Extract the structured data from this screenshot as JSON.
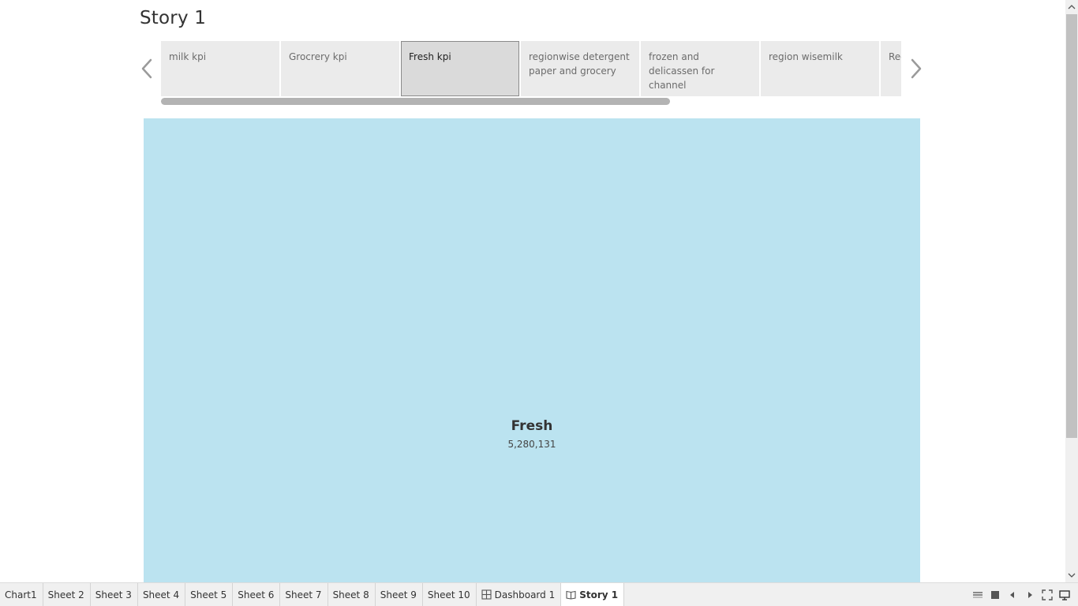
{
  "story": {
    "title": "Story 1",
    "points": [
      {
        "label": "milk kpi",
        "active": false
      },
      {
        "label": "Grocrery kpi",
        "active": false
      },
      {
        "label": "Fresh kpi",
        "active": true
      },
      {
        "label": "regionwise detergent paper and grocery",
        "active": false
      },
      {
        "label": "frozen and delicassen for channel",
        "active": false
      },
      {
        "label": "region wisemilk",
        "active": false
      },
      {
        "label": "Region",
        "active": false
      }
    ]
  },
  "viz": {
    "tile_name": "Fresh",
    "tile_value": "5,280,131",
    "tile_color": "#bbe3f0"
  },
  "tabs": [
    {
      "label": "Chart1",
      "icon": null
    },
    {
      "label": "Sheet 2",
      "icon": null
    },
    {
      "label": "Sheet 3",
      "icon": null
    },
    {
      "label": "Sheet 4",
      "icon": null
    },
    {
      "label": "Sheet 5",
      "icon": null
    },
    {
      "label": "Sheet 6",
      "icon": null
    },
    {
      "label": "Sheet 7",
      "icon": null
    },
    {
      "label": "Sheet 8",
      "icon": null
    },
    {
      "label": "Sheet 9",
      "icon": null
    },
    {
      "label": "Sheet 10",
      "icon": null
    },
    {
      "label": "Dashboard 1",
      "icon": "dashboard-icon"
    },
    {
      "label": "Story 1",
      "icon": "story-icon",
      "active": true
    }
  ],
  "tab_tools": [
    "show-sheet-sorter-icon",
    "show-filmstrip-icon",
    "previous-sheet-icon",
    "next-sheet-icon",
    "presentation-mode-icon",
    "device-preview-icon"
  ]
}
